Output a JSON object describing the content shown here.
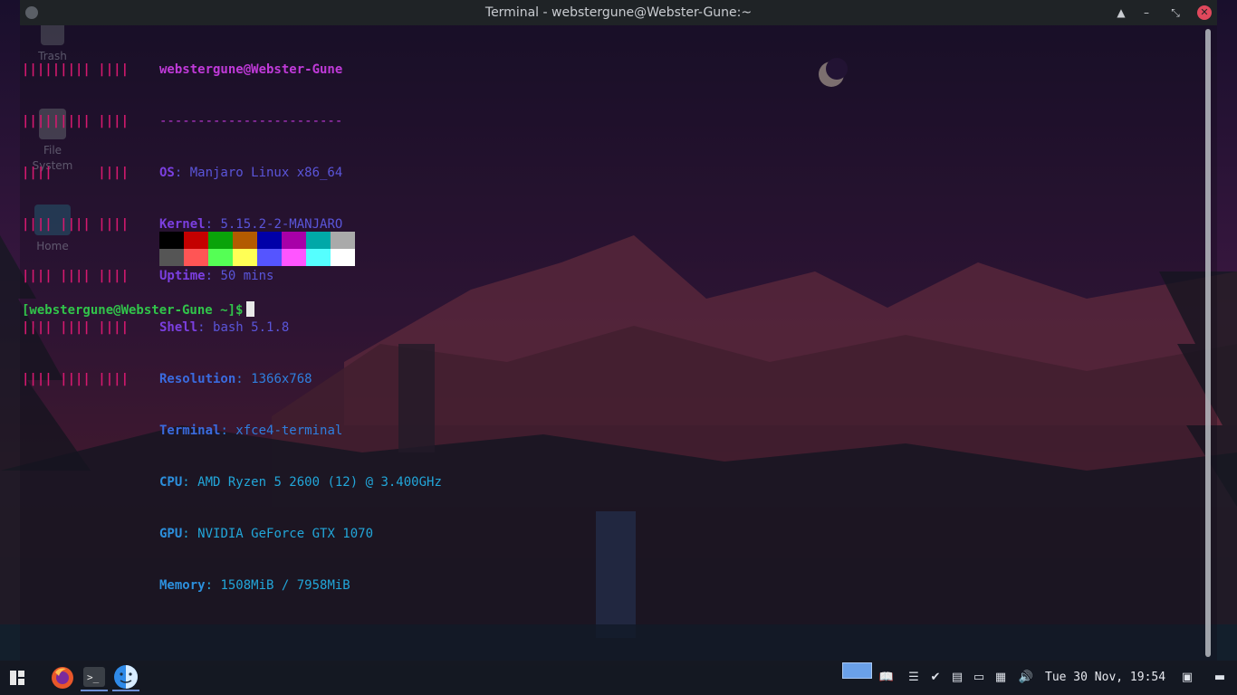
{
  "window": {
    "title": "Terminal - webstergune@Webster-Gune:~"
  },
  "desktop_icons": [
    {
      "label": "Trash",
      "icon": "trash-icon"
    },
    {
      "label": "File\nSystem",
      "icon": "drive-icon"
    },
    {
      "label": "Home",
      "icon": "home-folder-icon"
    }
  ],
  "neofetch": {
    "logo_lines": [
      "||||||||| ||||",
      "||||||||| ||||",
      "||||      ||||",
      "|||| |||| ||||",
      "|||| |||| ||||",
      "|||| |||| ||||",
      "|||| |||| ||||"
    ],
    "header": "webstergune@Webster-Gune",
    "separator": "------------------------",
    "rows": [
      {
        "key": "OS",
        "value": "Manjaro Linux x86_64"
      },
      {
        "key": "Kernel",
        "value": "5.15.2-2-MANJARO"
      },
      {
        "key": "Uptime",
        "value": "50 mins"
      },
      {
        "key": "Shell",
        "value": "bash 5.1.8"
      },
      {
        "key": "Resolution",
        "value": "1366x768"
      },
      {
        "key": "Terminal",
        "value": "xfce4-terminal"
      },
      {
        "key": "CPU",
        "value": "AMD Ryzen 5 2600 (12) @ 3.400GHz"
      },
      {
        "key": "GPU",
        "value": "NVIDIA GeForce GTX 1070"
      },
      {
        "key": "Memory",
        "value": "1508MiB / 7958MiB"
      }
    ],
    "palette_top": [
      "#000000",
      "#c40000",
      "#0aa30a",
      "#b35b00",
      "#0000a8",
      "#a800a8",
      "#00a8a8",
      "#aaaaaa"
    ],
    "palette_bottom": [
      "#555555",
      "#ff5555",
      "#55ff55",
      "#ffff55",
      "#5555ff",
      "#ff55ff",
      "#55ffff",
      "#ffffff"
    ]
  },
  "prompt": {
    "text": "[webstergune@Webster-Gune ~]$"
  },
  "taskbar": {
    "apps": [
      "menu-icon",
      "firefox-icon",
      "terminal-icon",
      "finder-icon"
    ],
    "clock": "Tue 30 Nov, 19:54",
    "tray": [
      "book-icon",
      "notes-icon",
      "check-icon",
      "clipboard-icon",
      "display-icon",
      "inbox-icon",
      "volume-icon"
    ]
  },
  "colors": {
    "logo": "#d5196f",
    "prompt": "#31c44a",
    "accent": "#c03ad9"
  }
}
